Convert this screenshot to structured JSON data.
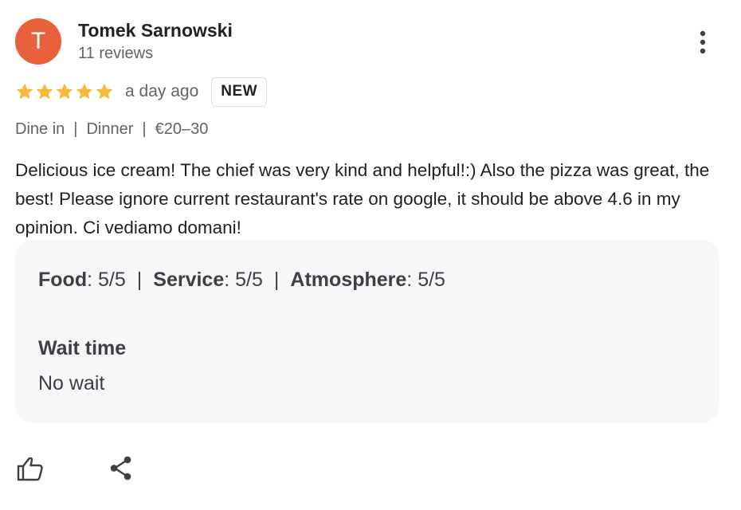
{
  "review": {
    "author": {
      "initial": "T",
      "name": "Tomek Sarnowski",
      "reviews_count": "11 reviews",
      "avatar_color": "#e8603c"
    },
    "rating": {
      "stars": 5,
      "max": 5,
      "star_color": "#f5b93e"
    },
    "age": "a day ago",
    "badge": "NEW",
    "meta": [
      "Dine in",
      "Dinner",
      "€20–30"
    ],
    "meta_separator": "|",
    "text": "Delicious ice cream! The chief was very kind and helpful!:) Also the pizza was great, the best! Please ignore current restaurant's rate on google, it should be above 4.6 in my opinion. Ci vediamo domani!",
    "attributes": {
      "separator": "|",
      "ratings": [
        {
          "label": "Food",
          "value": "5/5"
        },
        {
          "label": "Service",
          "value": "5/5"
        },
        {
          "label": "Atmosphere",
          "value": "5/5"
        }
      ],
      "wait_time_label": "Wait time",
      "wait_time_value": "No wait"
    },
    "actions": {
      "like_icon": "thumb-up-icon",
      "share_icon": "share-icon",
      "more_icon": "more-vert-icon"
    }
  }
}
